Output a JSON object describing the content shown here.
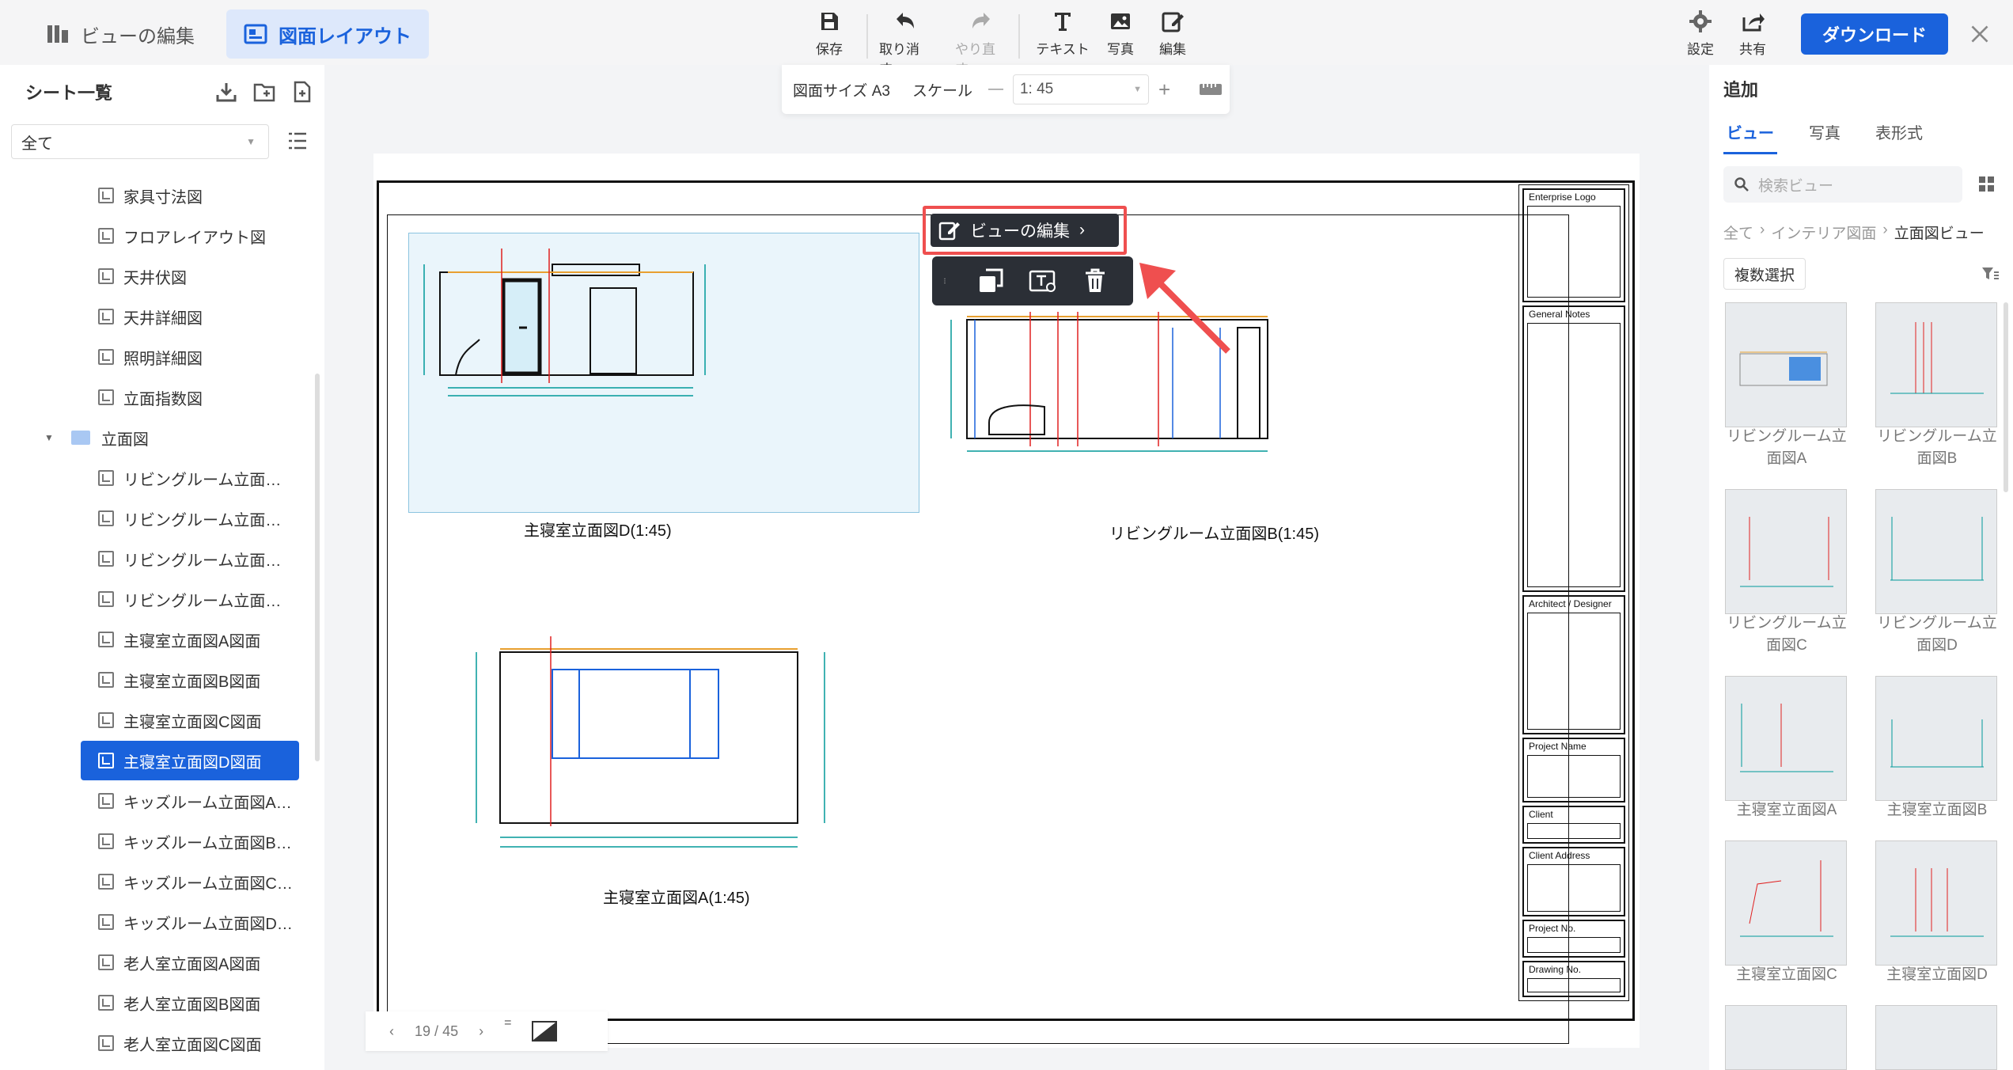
{
  "header": {
    "view_edit_tab": "ビューの編集",
    "layout_tab": "図面レイアウト",
    "tools": [
      {
        "label": "保存",
        "icon": "save-icon"
      },
      {
        "label": "取り消す",
        "icon": "undo-icon"
      },
      {
        "label": "やり直す",
        "icon": "redo-icon"
      },
      {
        "label": "テキスト",
        "icon": "text-icon"
      },
      {
        "label": "写真",
        "icon": "image-icon"
      },
      {
        "label": "編集",
        "icon": "edit-icon"
      }
    ],
    "settings": "設定",
    "share": "共有",
    "download": "ダウンロード"
  },
  "sheet_toolbar": {
    "size_label": "図面サイズ A3",
    "scale_label": "スケール",
    "scale_value": "1: 45",
    "minus": "—",
    "plus": "+"
  },
  "sidebar": {
    "title": "シート一覧",
    "filter": "全て",
    "items": [
      "家具寸法図",
      "フロアレイアウト図",
      "天井伏図",
      "天井詳細図",
      "照明詳細図",
      "立面指数図",
      "立面図",
      "リビングルーム立面…",
      "リビングルーム立面…",
      "リビングルーム立面…",
      "リビングルーム立面…",
      "主寝室立面図A図面",
      "主寝室立面図B図面",
      "主寝室立面図C図面",
      "主寝室立面図D図面",
      "キッズルーム立面図A…",
      "キッズルーム立面図B…",
      "キッズルーム立面図C…",
      "キッズルーム立面図D…",
      "老人室立面図A図面",
      "老人室立面図B図面",
      "老人室立面図C図面"
    ]
  },
  "drawing": {
    "caption_d": "主寝室立面図D(1:45)",
    "caption_b": "リビングルーム立面図B(1:45)",
    "caption_a": "主寝室立面図A(1:45)",
    "title_block": [
      "Enterprise Logo",
      "General Notes",
      "Architect / Designer",
      "Project Name",
      "Client",
      "Client Address",
      "Project No.",
      "Drawing No."
    ],
    "popover_label": "ビューの編集"
  },
  "pager": {
    "current": "19",
    "sep": "/",
    "total": "45"
  },
  "right_panel": {
    "title": "追加",
    "tabs": [
      "ビュー",
      "写真",
      "表形式"
    ],
    "search_placeholder": "検索ビュー",
    "breadcrumb": [
      "全て",
      "インテリア図面",
      "立面図ビュー"
    ],
    "multi_select": "複数選択",
    "thumbs": [
      [
        "リビングルーム立",
        "面図A"
      ],
      [
        "リビングルーム立",
        "面図B"
      ],
      [
        "リビングルーム立",
        "面図C"
      ],
      [
        "リビングルーム立",
        "面図D"
      ],
      [
        "主寝室立面図A",
        ""
      ],
      [
        "主寝室立面図B",
        ""
      ],
      [
        "主寝室立面図C",
        ""
      ],
      [
        "主寝室立面図D",
        ""
      ]
    ]
  },
  "colors": {
    "accent": "#1a62dc",
    "highlight_border": "#ef4f4f",
    "dim_line": "#009999",
    "axis_red": "#e02020"
  }
}
